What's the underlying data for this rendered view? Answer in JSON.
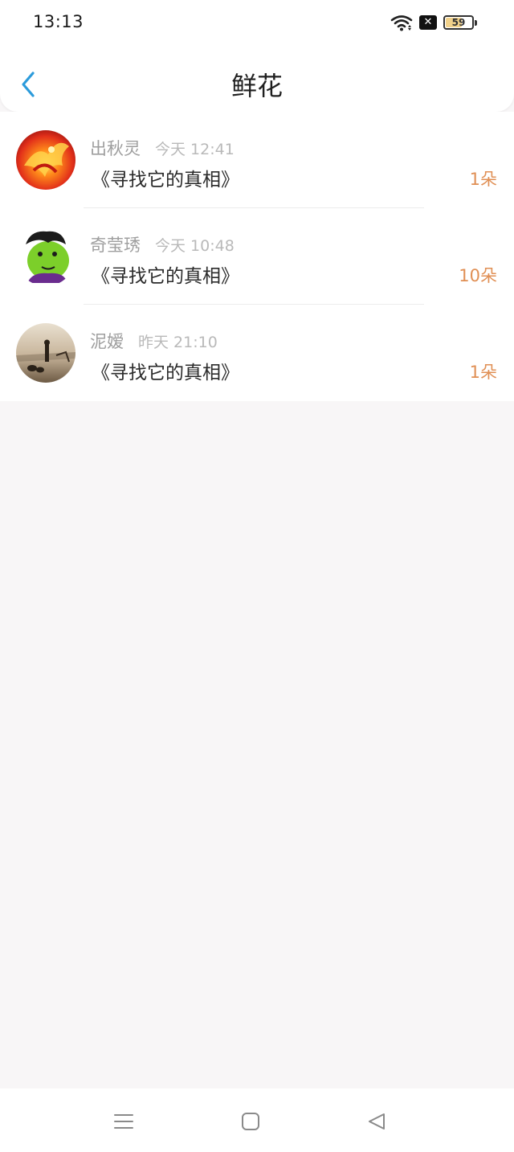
{
  "status_bar": {
    "time": "13:13",
    "battery": "59"
  },
  "header": {
    "title": "鲜花"
  },
  "items": [
    {
      "name": "出秋灵",
      "time": "今天 12:41",
      "book": "《寻找它的真相》",
      "count": "1朵"
    },
    {
      "name": "奇莹琇",
      "time": "今天 10:48",
      "book": "《寻找它的真相》",
      "count": "10朵"
    },
    {
      "name": "泥嫒",
      "time": "昨天 21:10",
      "book": "《寻找它的真相》",
      "count": "1朵"
    }
  ],
  "colors": {
    "accent_blue": "#2c9bdb",
    "count_orange": "#e08f54"
  },
  "icons": {
    "back": "chevron-left-icon",
    "menu": "menu-icon",
    "home": "home-square-icon",
    "nav_back": "triangle-back-icon"
  }
}
